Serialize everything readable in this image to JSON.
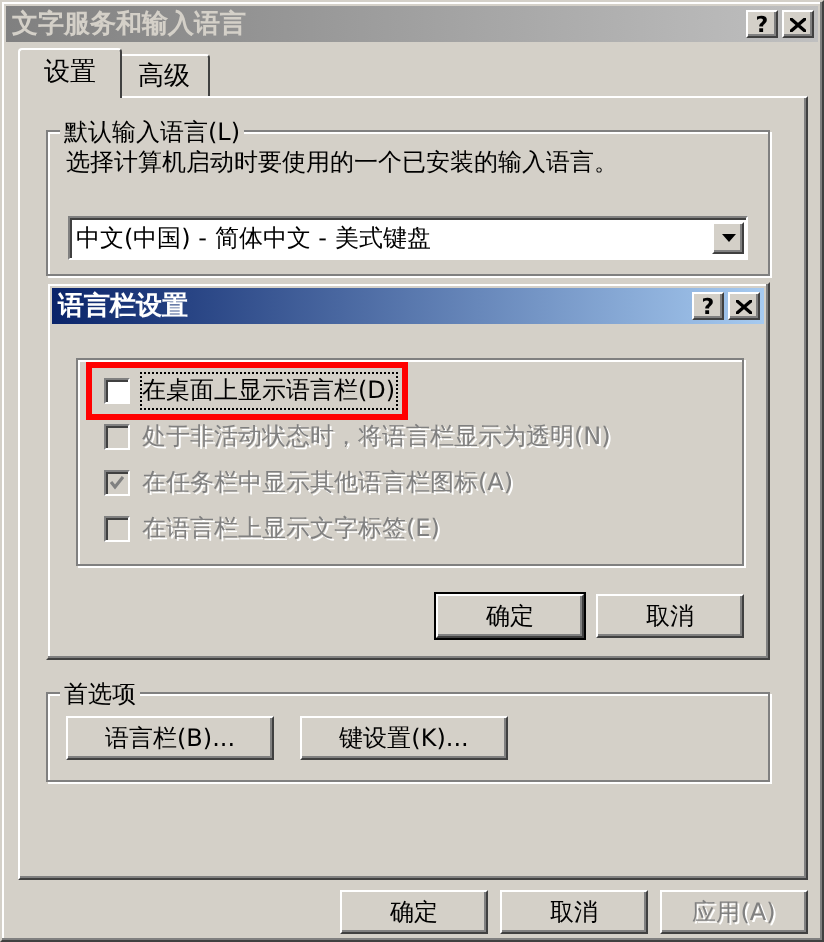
{
  "window": {
    "title": "文字服务和输入语言",
    "help_button": "?"
  },
  "tabs": [
    {
      "label": "设置",
      "selected": true
    },
    {
      "label": "高级",
      "selected": false
    }
  ],
  "default_language": {
    "title": "默认输入语言(L)",
    "description": "选择计算机启动时要使用的一个已安装的输入语言。",
    "dropdown": {
      "value": "中文(中国) - 简体中文 - 美式键盘"
    }
  },
  "language_bar_dialog": {
    "title": "语言栏设置",
    "help_button": "?",
    "options": [
      {
        "label": "在桌面上显示语言栏(D)",
        "checked": false,
        "disabled": false,
        "highlighted": true
      },
      {
        "label": "处于非活动状态时，将语言栏显示为透明(N)",
        "checked": false,
        "disabled": true,
        "highlighted": false
      },
      {
        "label": "在任务栏中显示其他语言栏图标(A)",
        "checked": true,
        "disabled": true,
        "highlighted": false
      },
      {
        "label": "在语言栏上显示文字标签(E)",
        "checked": false,
        "disabled": true,
        "highlighted": false
      }
    ],
    "buttons": [
      {
        "label": "确定",
        "default": true
      },
      {
        "label": "取消",
        "default": false
      }
    ]
  },
  "preferences": {
    "title": "首选项",
    "buttons": [
      "语言栏(B)...",
      "键设置(K)..."
    ]
  },
  "footer_buttons": [
    {
      "label": "确定",
      "disabled": false
    },
    {
      "label": "取消",
      "disabled": false
    },
    {
      "label": "应用(A)",
      "disabled": true
    }
  ]
}
